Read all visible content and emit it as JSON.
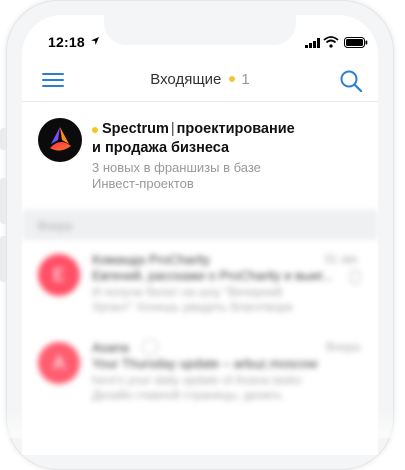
{
  "status_bar": {
    "time": "12:18",
    "icons": [
      "location-arrow-icon",
      "signal-icon",
      "wifi-icon",
      "battery-icon"
    ]
  },
  "nav": {
    "title": "Входящие",
    "unread_count": "1",
    "menu_icon": "hamburger-menu-icon",
    "search_icon": "search-icon"
  },
  "colors": {
    "accent": "#2a7fd0",
    "unread_dot": "#f5c518",
    "avatar_red": "#ff4f66"
  },
  "emails": [
    {
      "sender": "Spectrum",
      "separator": "|",
      "sender_suffix": "проектирование",
      "subject": "и продажа бизнеса",
      "preview_line1": "3 новых в франшизы в базе",
      "preview_line2": "Инвест-проектов",
      "unread": true
    }
  ],
  "blurred": {
    "section_label": "Вчера",
    "items": [
      {
        "initial": "E",
        "sender": "Команда ProCharity",
        "date": "31 авг.",
        "subject": "Евгений, расскажи о ProCharity и выиг...",
        "preview_line1": "И получи билет на шоу \"Вечерний",
        "preview_line2": "Ургант\" Хочешь увидеть благотвори"
      },
      {
        "initial": "A",
        "sender": "Asana",
        "date": "Вчера",
        "subject": "Your Thursday update – arbuz.moscow",
        "preview_line1": "here's your daily update of Asana tasks:",
        "preview_line2": "Дизайн главной страницы, дизигн,"
      }
    ]
  }
}
